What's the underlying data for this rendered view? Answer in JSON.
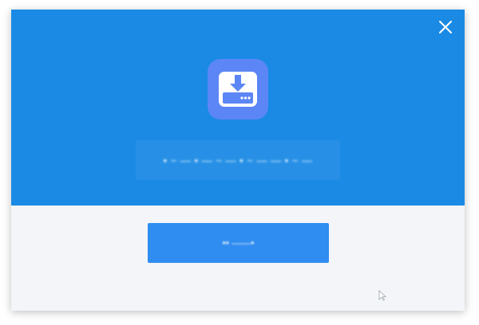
{
  "dialog": {
    "close_icon": "close-icon",
    "app_icon": "download-drive-icon",
    "message": "• ~ — • — ~ — • ~ — — • ~ —",
    "action_button_label": "•• ——•",
    "colors": {
      "header": "#1a8ae5",
      "body": "#f3f5f8",
      "icon_tile": "#5c86f5",
      "button": "#2f8cf0"
    }
  }
}
